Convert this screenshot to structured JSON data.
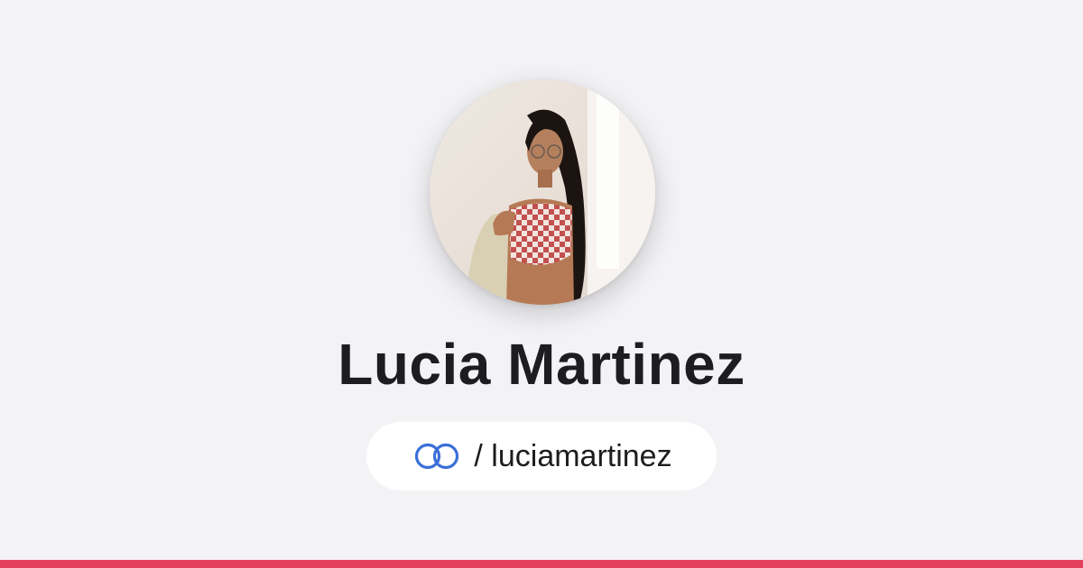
{
  "profile": {
    "name": "Lucia Martinez",
    "handle_prefix": "/",
    "handle": "luciamartinez",
    "avatar_icon": "profile-photo"
  },
  "brand": {
    "logo_icon": "linked-rings-icon",
    "logo_color": "#3b6fd8",
    "accent_bar_color": "#e4415f"
  }
}
